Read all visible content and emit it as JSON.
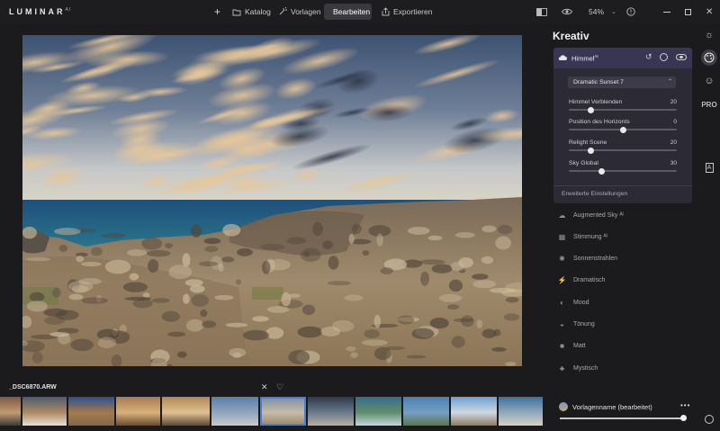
{
  "app": {
    "logo": "LUMINAR",
    "logo_sup": "AI"
  },
  "toolbar": {
    "add_symbol": "+",
    "catalog": "Katalog",
    "templates": "Vorlagen",
    "edit": "Bearbeiten",
    "export": "Exportieren",
    "zoom": "54%"
  },
  "panel": {
    "title": "Kreativ",
    "sky": {
      "title": "Himmel",
      "title_sup": "AI",
      "preset": "Dramatic Sunset 7",
      "sliders": [
        {
          "label": "Himmel Verblenden",
          "value": "20",
          "level": 0.2
        },
        {
          "label": "Position des Horizonts",
          "value": "0",
          "level": 0.5
        },
        {
          "label": "Relight Scene",
          "value": "20",
          "level": 0.2
        },
        {
          "label": "Sky Global",
          "value": "30",
          "level": 0.3
        }
      ],
      "advanced": "Erweiterte Einstellungen"
    },
    "tools": [
      {
        "label": "Augmented Sky ᴬᴵ",
        "icon": "cloud-icon"
      },
      {
        "label": "Stimmung ᴬᴵ",
        "icon": "mood-grid-icon"
      },
      {
        "label": "Sonnenstrahlen",
        "icon": "sun-rays-icon"
      },
      {
        "label": "Dramatisch",
        "icon": "lightning-icon"
      },
      {
        "label": "Mood",
        "icon": "circle-icon"
      },
      {
        "label": "Tönung",
        "icon": "toning-icon"
      },
      {
        "label": "Matt",
        "icon": "square-icon"
      },
      {
        "label": "Mystisch",
        "icon": "mystic-icon"
      }
    ],
    "rail": {
      "pro": "PRO"
    }
  },
  "filmstrip": {
    "filename": "_DSC6870.ARW",
    "selected_index": 6
  },
  "preset_bar": {
    "name": "Vorlagenname (bearbeitet)",
    "more": "•••",
    "level": 0.98
  },
  "colors": {
    "accent": "#4a7fd6",
    "panel": "#2b2a35",
    "header": "#383652"
  }
}
